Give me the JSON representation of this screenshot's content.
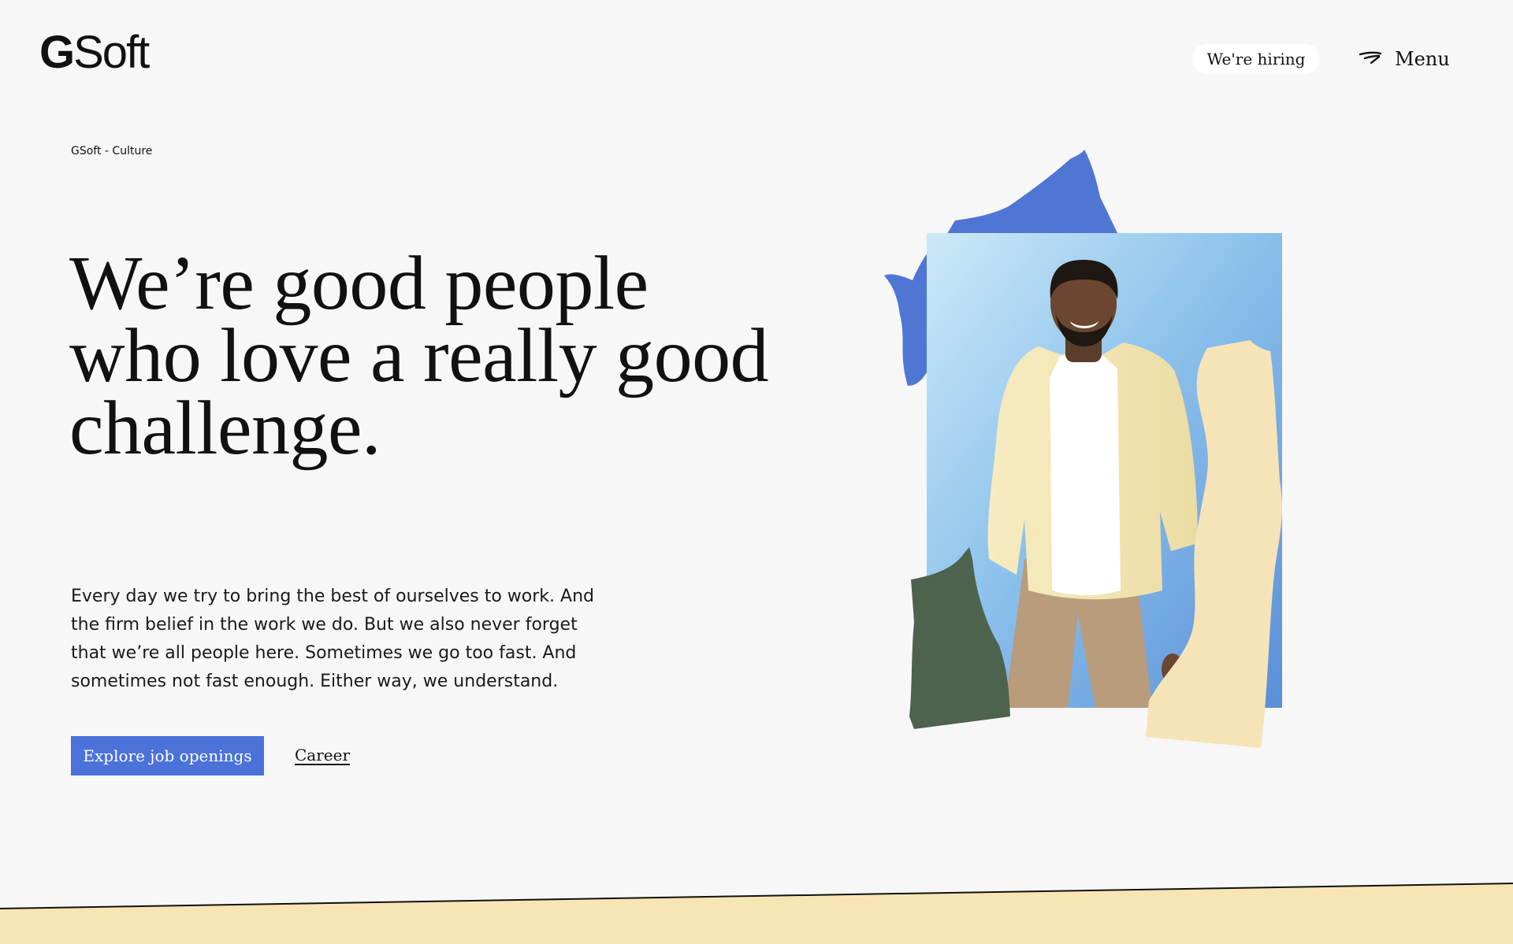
{
  "header": {
    "logo_bold": "G",
    "logo_rest": "Soft",
    "hiring_label": "We're hiring",
    "menu_label": "Menu"
  },
  "breadcrumb": "GSoft - Culture",
  "hero": {
    "headline": "We’re good people who love a really good challenge.",
    "body": "Every day we try to bring the best of ourselves to work. And the firm belief in the work we do. But we also never forget that we’re all people here. Sometimes we go too fast. And sometimes not fast enough. Either way, we understand.",
    "cta_label": "Explore job openings",
    "link_label": "Career"
  },
  "colors": {
    "accent_blue": "#4b72d8",
    "shape_blue": "#5076d4",
    "shape_green": "#4d634d",
    "shape_cream": "#f6e4b8",
    "band_cream": "#f8e5b4",
    "background": "#f7f7f7"
  },
  "icons": {
    "menu": "swoosh-menu-icon",
    "photo": "smiling-man-portrait"
  }
}
